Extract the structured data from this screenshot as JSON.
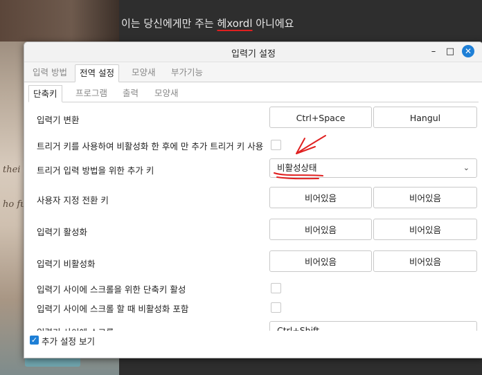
{
  "background": {
    "top_text_pre": "이는 당신에게만 주는 ",
    "top_text_underlined": "헤xordl",
    "top_text_post": " 아니에요",
    "script_lines": [
      "thei",
      "ho fu"
    ]
  },
  "dialog": {
    "title": "입력기 설정",
    "main_tabs": [
      "입력 방법",
      "전역 설정",
      "모양새",
      "부가기능"
    ],
    "sub_tabs": [
      "단축키",
      "프로그램",
      "출력",
      "모양새"
    ],
    "rows": {
      "toggle": {
        "label": "입력기 변환",
        "key1": "Ctrl+Space",
        "key2": "Hangul"
      },
      "trigger_only": {
        "label": "트리거 키를 사용하여 비활성화 한 후에 만 추가 트리거 키 사용"
      },
      "extra_trigger": {
        "label": "트리거 입력 방법을 위한 추가 키",
        "value": "비활성상태"
      },
      "custom_switch": {
        "label": "사용자 지정 전환 키",
        "key1": "비어있음",
        "key2": "비어있음"
      },
      "activate": {
        "label": "입력기 활성화",
        "key1": "비어있음",
        "key2": "비어있음"
      },
      "deactivate": {
        "label": "입력기 비활성화",
        "key1": "비어있음",
        "key2": "비어있음"
      },
      "scroll_shortcut": {
        "label": "입력기 사이에 스크롤을 위한 단축키 활성"
      },
      "scroll_include": {
        "label": "입력기 사이에 스크롤 할 때 비활성화 포함"
      },
      "scroll_between": {
        "label": "입력기 사이에 스크롤",
        "value": "Ctrl+Shift"
      }
    },
    "footer": {
      "show_advanced": "추가 설정 보기"
    }
  },
  "colors": {
    "accent": "#1e7fd6",
    "annotation": "#e02020"
  }
}
